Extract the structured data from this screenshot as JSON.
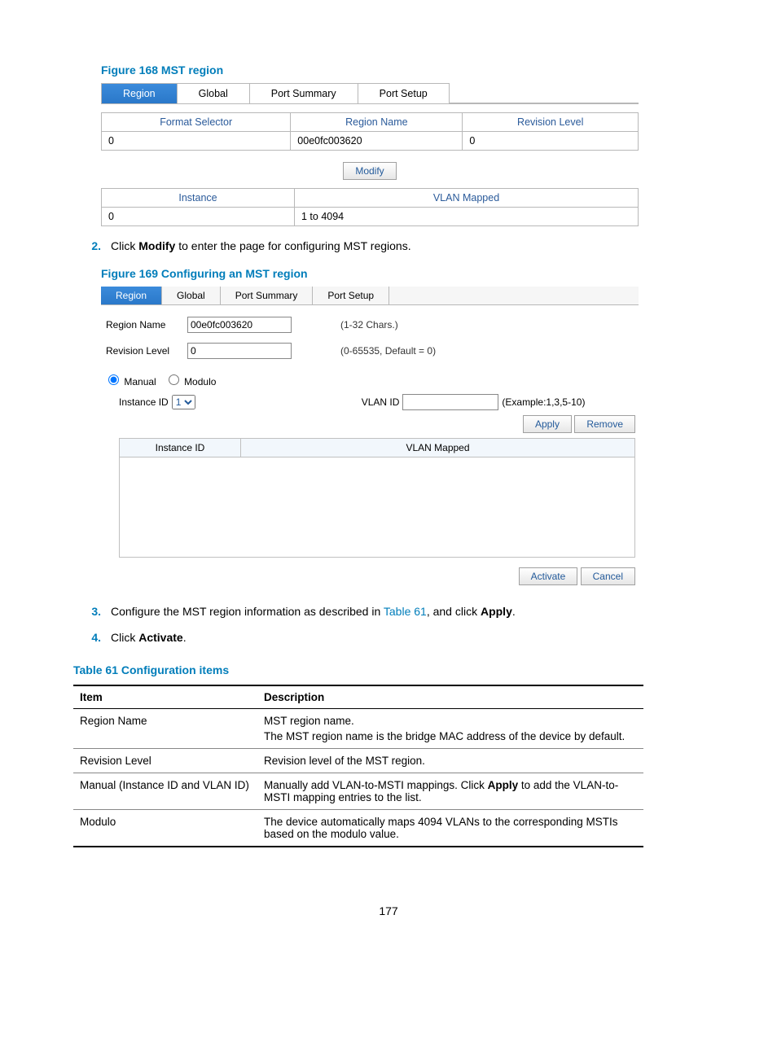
{
  "figure168": {
    "title": "Figure 168 MST region",
    "tabs": [
      "Region",
      "Global",
      "Port Summary",
      "Port Setup"
    ],
    "headers": [
      "Format Selector",
      "Region Name",
      "Revision Level"
    ],
    "row": [
      "0",
      "00e0fc003620",
      "0"
    ],
    "modify_btn": "Modify",
    "inst_headers": [
      "Instance",
      "VLAN Mapped"
    ],
    "inst_row": [
      "0",
      "1 to 4094"
    ]
  },
  "step2": {
    "num": "2.",
    "text_a": "Click ",
    "bold": "Modify",
    "text_b": " to enter the page for configuring MST regions."
  },
  "figure169": {
    "title": "Figure 169 Configuring an MST region",
    "tabs": [
      "Region",
      "Global",
      "Port Summary",
      "Port Setup"
    ],
    "region_name_label": "Region Name",
    "region_name_value": "00e0fc003620",
    "region_name_hint": "(1-32 Chars.)",
    "revision_label": "Revision Level",
    "revision_value": "0",
    "revision_hint": "(0-65535, Default = 0)",
    "radio_manual": "Manual",
    "radio_modulo": "Modulo",
    "instance_id_label": "Instance ID",
    "instance_id_value": "1",
    "vlan_id_label": "VLAN ID",
    "vlan_id_hint": "(Example:1,3,5-10)",
    "apply_btn": "Apply",
    "remove_btn": "Remove",
    "table_headers": [
      "Instance ID",
      "VLAN Mapped"
    ],
    "activate_btn": "Activate",
    "cancel_btn": "Cancel"
  },
  "step3": {
    "num": "3.",
    "text_a": "Configure the MST region information as described in ",
    "link": "Table 61",
    "text_b": ", and click ",
    "bold": "Apply",
    "text_c": "."
  },
  "step4": {
    "num": "4.",
    "text_a": "Click ",
    "bold": "Activate",
    "text_b": "."
  },
  "table61": {
    "title": "Table 61 Configuration items",
    "headers": [
      "Item",
      "Description"
    ],
    "rows": [
      {
        "item": "Region Name",
        "desc_a": "MST region name.",
        "desc_b": "The MST region name is the bridge MAC address of the device by default."
      },
      {
        "item": "Revision Level",
        "desc_a": "Revision level of the MST region."
      },
      {
        "item": "Manual (Instance ID and VLAN ID)",
        "desc_a": "Manually add VLAN-to-MSTI mappings. Click ",
        "bold": "Apply",
        "desc_b": " to add the VLAN-to-MSTI mapping entries to the list."
      },
      {
        "item": "Modulo",
        "desc_a": "The device automatically maps 4094 VLANs to the corresponding MSTIs based on the modulo value."
      }
    ]
  },
  "page_number": "177"
}
